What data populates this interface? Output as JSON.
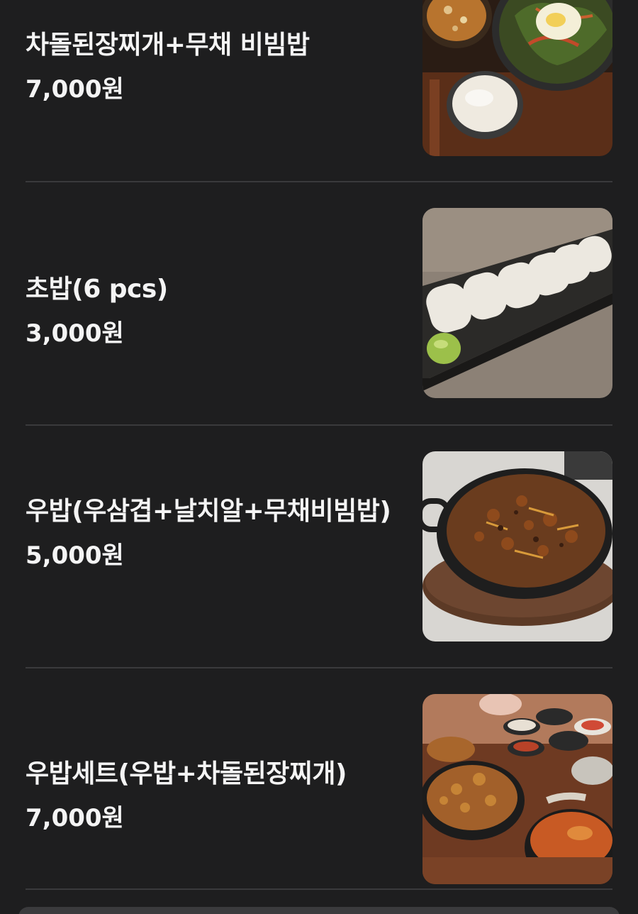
{
  "menu": {
    "items": [
      {
        "name": "차돌된장찌개+무채 비빔밥",
        "price": "7,000원",
        "photo_icon": "bibimbap-stew-photo"
      },
      {
        "name": "초밥(6 pcs)",
        "price": "3,000원",
        "photo_icon": "sushi-rice-photo"
      },
      {
        "name": "우밥(우삼겹+날치알+무채비빔밥)",
        "price": "5,000원",
        "photo_icon": "stirfry-pan-photo"
      },
      {
        "name": "우밥세트(우밥+차돌된장찌개)",
        "price": "7,000원",
        "photo_icon": "set-meal-photo"
      }
    ]
  },
  "colors": {
    "background": "#1e1e1f",
    "text": "#f4f4f4",
    "divider": "#3a3a3c"
  }
}
